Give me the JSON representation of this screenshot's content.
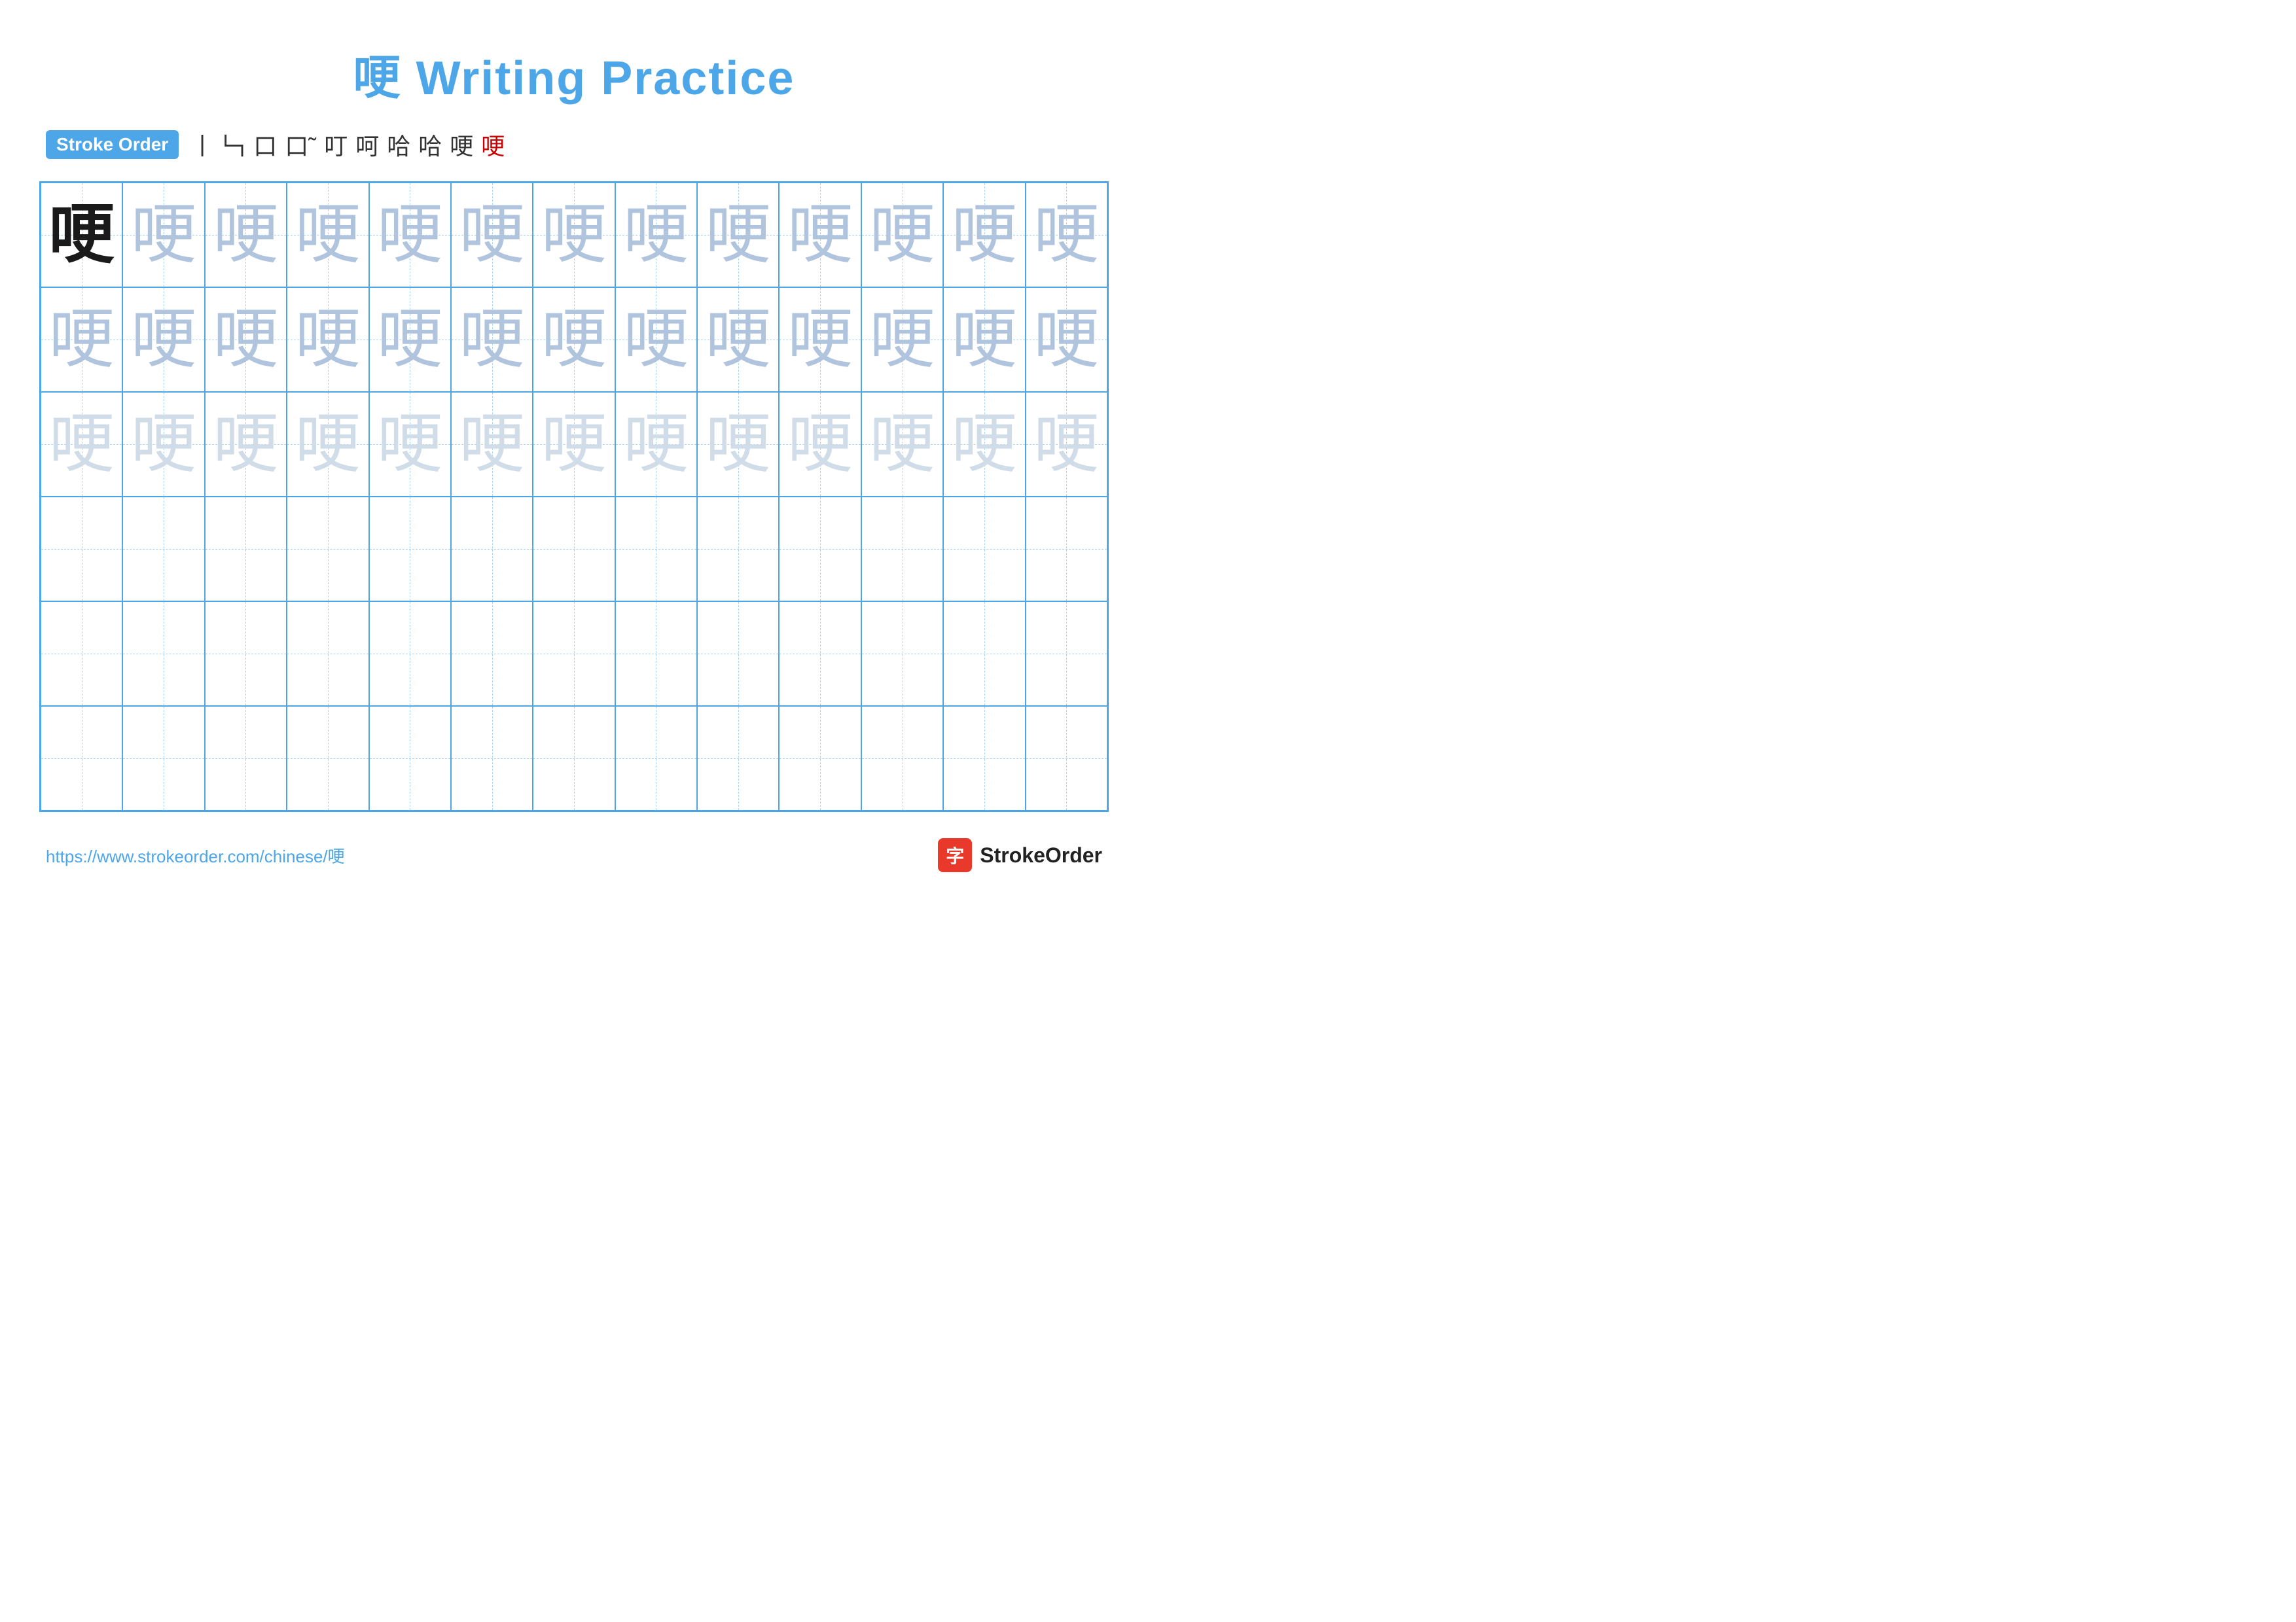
{
  "page": {
    "title": "哽 Writing Practice",
    "title_char": "哽",
    "title_suffix": " Writing Practice"
  },
  "stroke_order": {
    "badge_label": "Stroke Order",
    "strokes": [
      "丨",
      "𠃑",
      "口",
      "口⁻",
      "叮",
      "呵",
      "哈",
      "哈",
      "哽",
      "哽"
    ]
  },
  "grid": {
    "rows": 6,
    "cols": 13,
    "char": "哽",
    "cells": [
      {
        "type": "dark"
      },
      {
        "type": "medium"
      },
      {
        "type": "medium"
      },
      {
        "type": "medium"
      },
      {
        "type": "medium"
      },
      {
        "type": "medium"
      },
      {
        "type": "medium"
      },
      {
        "type": "medium"
      },
      {
        "type": "medium"
      },
      {
        "type": "medium"
      },
      {
        "type": "medium"
      },
      {
        "type": "medium"
      },
      {
        "type": "medium"
      },
      {
        "type": "medium"
      },
      {
        "type": "medium"
      },
      {
        "type": "medium"
      },
      {
        "type": "medium"
      },
      {
        "type": "medium"
      },
      {
        "type": "medium"
      },
      {
        "type": "medium"
      },
      {
        "type": "medium"
      },
      {
        "type": "medium"
      },
      {
        "type": "medium"
      },
      {
        "type": "medium"
      },
      {
        "type": "medium"
      },
      {
        "type": "medium"
      },
      {
        "type": "light"
      },
      {
        "type": "light"
      },
      {
        "type": "light"
      },
      {
        "type": "light"
      },
      {
        "type": "light"
      },
      {
        "type": "light"
      },
      {
        "type": "light"
      },
      {
        "type": "light"
      },
      {
        "type": "light"
      },
      {
        "type": "light"
      },
      {
        "type": "light"
      },
      {
        "type": "light"
      },
      {
        "type": "light"
      },
      {
        "type": "empty"
      },
      {
        "type": "empty"
      },
      {
        "type": "empty"
      },
      {
        "type": "empty"
      },
      {
        "type": "empty"
      },
      {
        "type": "empty"
      },
      {
        "type": "empty"
      },
      {
        "type": "empty"
      },
      {
        "type": "empty"
      },
      {
        "type": "empty"
      },
      {
        "type": "empty"
      },
      {
        "type": "empty"
      },
      {
        "type": "empty"
      },
      {
        "type": "empty"
      },
      {
        "type": "empty"
      },
      {
        "type": "empty"
      },
      {
        "type": "empty"
      },
      {
        "type": "empty"
      },
      {
        "type": "empty"
      },
      {
        "type": "empty"
      },
      {
        "type": "empty"
      },
      {
        "type": "empty"
      },
      {
        "type": "empty"
      },
      {
        "type": "empty"
      },
      {
        "type": "empty"
      },
      {
        "type": "empty"
      },
      {
        "type": "empty"
      },
      {
        "type": "empty"
      },
      {
        "type": "empty"
      },
      {
        "type": "empty"
      },
      {
        "type": "empty"
      },
      {
        "type": "empty"
      },
      {
        "type": "empty"
      },
      {
        "type": "empty"
      },
      {
        "type": "empty"
      },
      {
        "type": "empty"
      },
      {
        "type": "empty"
      },
      {
        "type": "empty"
      },
      {
        "type": "empty"
      }
    ]
  },
  "footer": {
    "url": "https://www.strokeorder.com/chinese/哽",
    "brand_icon": "字",
    "brand_name": "StrokeOrder"
  }
}
